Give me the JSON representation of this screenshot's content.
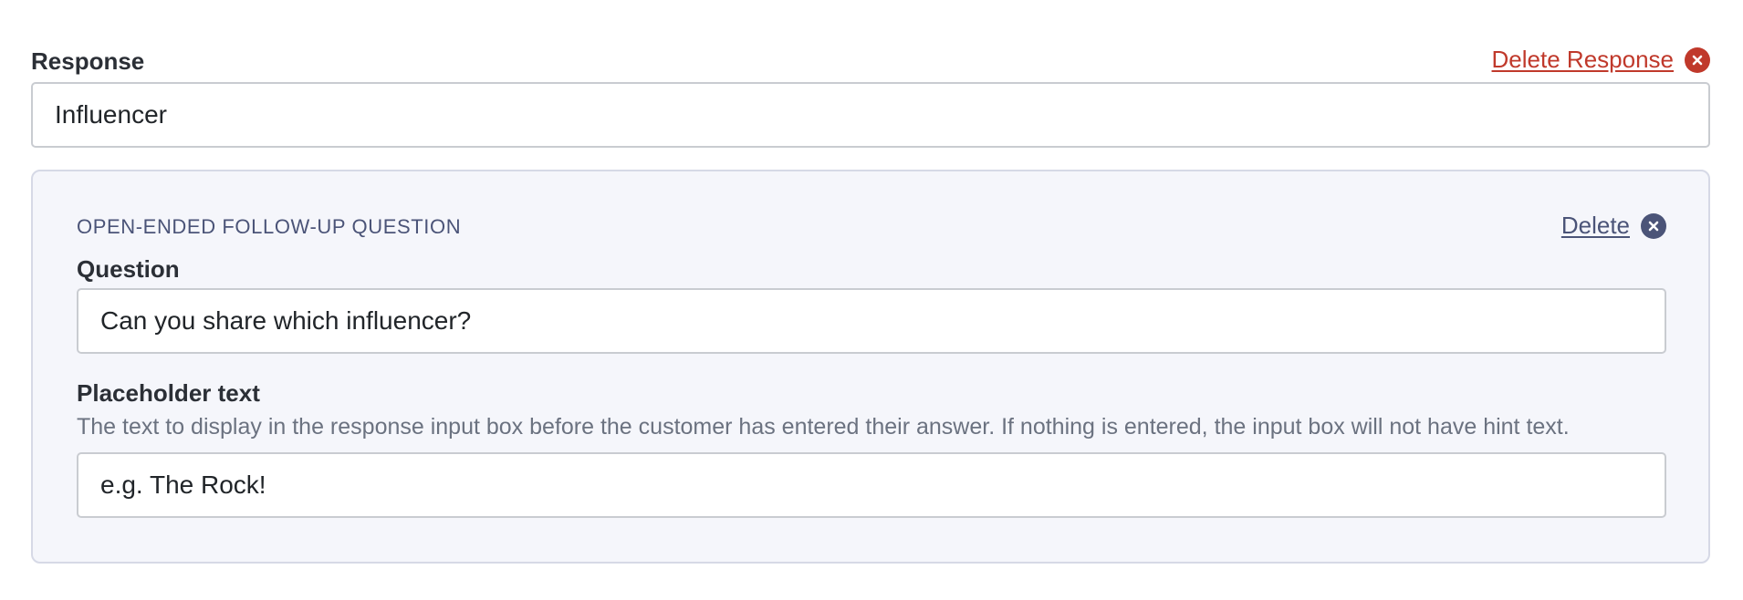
{
  "response": {
    "label": "Response",
    "value": "Influencer",
    "delete_label": "Delete Response",
    "delete_icon": "close-circle-icon",
    "delete_color": "#c0392b"
  },
  "followup": {
    "title": "OPEN-ENDED FOLLOW-UP QUESTION",
    "delete_label": "Delete",
    "delete_icon": "close-circle-icon",
    "accent_color": "#4b5478",
    "question": {
      "label": "Question",
      "value": "Can you share which influencer?"
    },
    "placeholder": {
      "label": "Placeholder text",
      "help": "The text to display in the response input box before the customer has entered their answer. If nothing is entered, the input box will not have hint text.",
      "value": "e.g. The Rock!"
    }
  }
}
